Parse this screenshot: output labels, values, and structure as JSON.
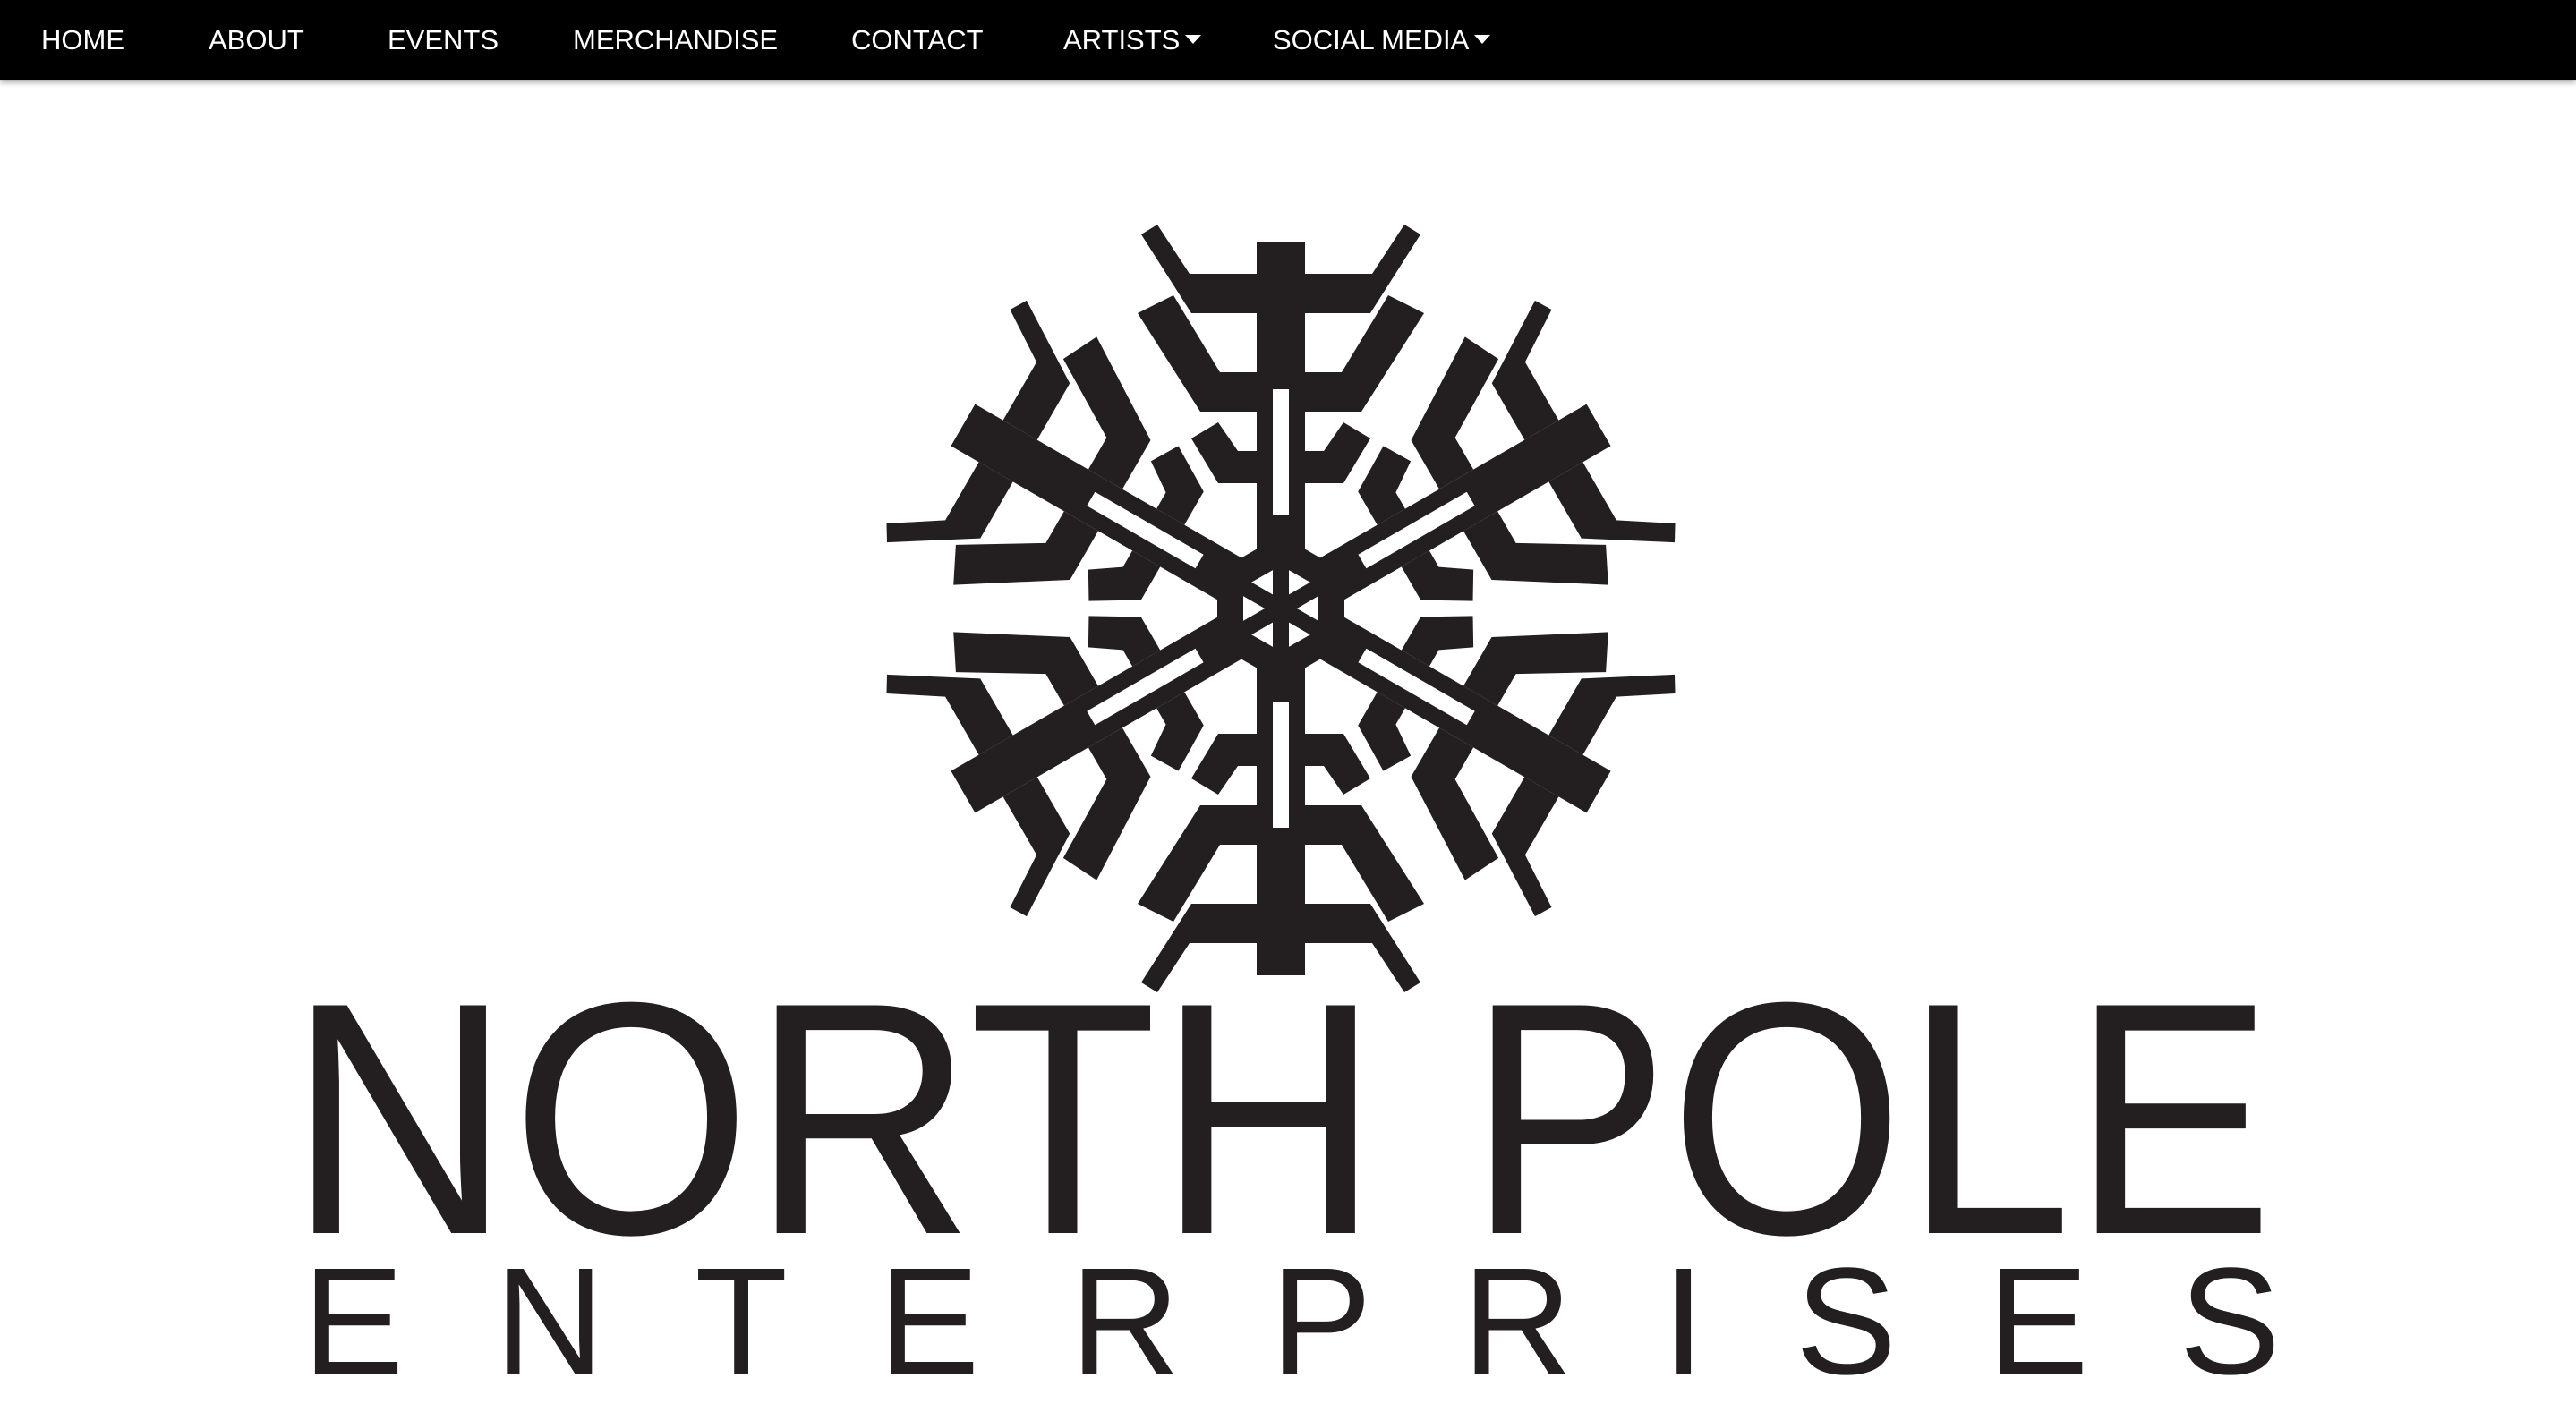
{
  "nav": {
    "items": [
      {
        "label": "HOME",
        "has_dropdown": false
      },
      {
        "label": "ABOUT",
        "has_dropdown": false
      },
      {
        "label": "EVENTS",
        "has_dropdown": false
      },
      {
        "label": "MERCHANDISE",
        "has_dropdown": false
      },
      {
        "label": "CONTACT",
        "has_dropdown": false
      },
      {
        "label": "ARTISTS",
        "has_dropdown": true
      },
      {
        "label": "SOCIAL MEDIA",
        "has_dropdown": true
      }
    ]
  },
  "logo": {
    "line1_left": "NORTH",
    "line1_right": "POLE",
    "line2": "ENTERPRISES",
    "icon": "snowflake-icon"
  },
  "colors": {
    "navbar": "#000000",
    "nav_text": "#ffffff",
    "logo": "#231f20",
    "background": "#ffffff"
  }
}
